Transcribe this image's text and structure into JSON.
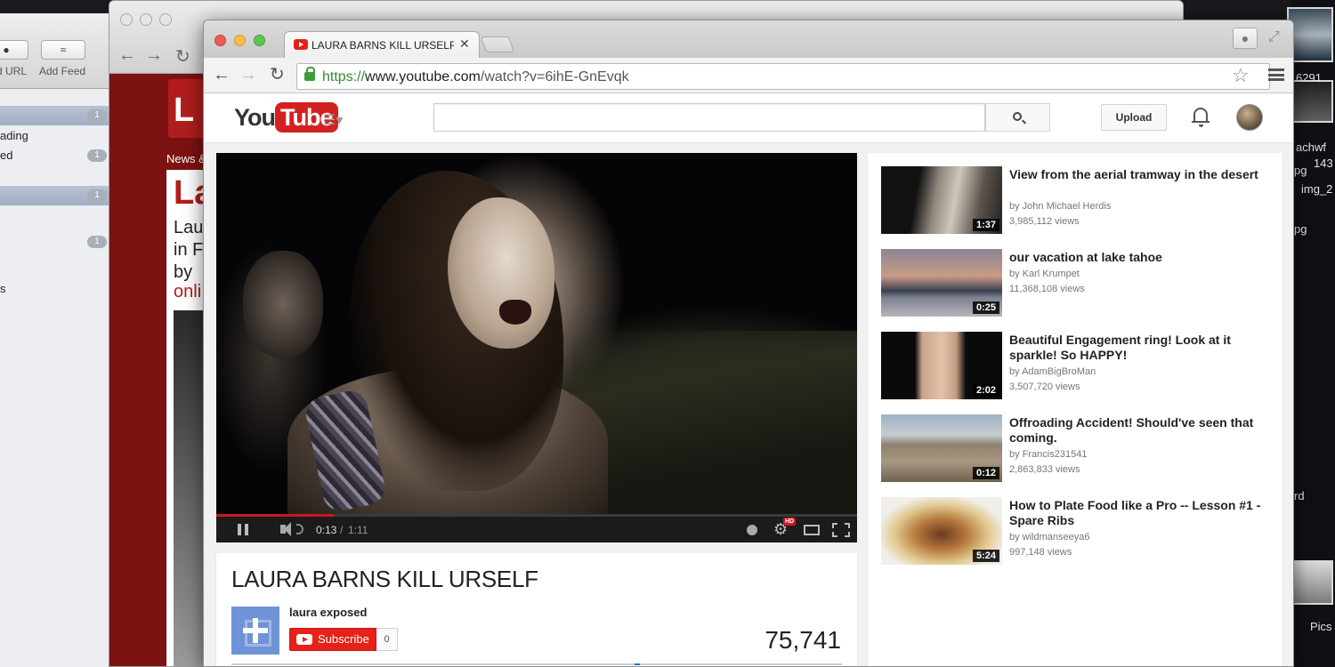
{
  "rss_window": {
    "toolbar": [
      {
        "label": "d URL"
      },
      {
        "label": "Add Feed"
      }
    ],
    "rows": [
      "ading",
      "ed",
      "s"
    ],
    "badges": [
      "1",
      "1",
      "1",
      "1"
    ]
  },
  "browser_back": {
    "section_label": "News &",
    "headline": "La",
    "lines": [
      "Lau",
      "in F",
      "by"
    ],
    "link_text": "onli"
  },
  "desktop": {
    "labels": [
      "6291",
      "achwf",
      "143",
      "img_2",
      "pg",
      "pg",
      "rd",
      "Pics"
    ]
  },
  "browser": {
    "tab_title": "LAURA BARNS KILL URSELF",
    "url_scheme": "https://",
    "url_host": "www.youtube.com",
    "url_path": "/watch?v=6ihE-GnEvqk"
  },
  "youtube": {
    "logo_you": "You",
    "logo_tube": "Tube",
    "search_placeholder": "",
    "upload_label": "Upload",
    "player": {
      "time_current": "0:13",
      "time_separator": "/",
      "time_duration": "1:11",
      "progress": 0.183,
      "hd_label": "HD"
    },
    "watch": {
      "title": "LAURA BARNS KILL URSELF",
      "channel": "laura exposed",
      "subscribe_label": "Subscribe",
      "subscriber_count": "0",
      "views": "75,741",
      "like_ratio": 0.66
    },
    "related": [
      {
        "title": "View from the aerial tramway in the desert",
        "by": "by John Michael Herdis",
        "views": "3,985,112 views",
        "duration": "1:37"
      },
      {
        "title": "our vacation at lake tahoe",
        "by": "by Karl Krumpet",
        "views": "11,368,108 views",
        "duration": "0:25"
      },
      {
        "title": "Beautiful Engagement ring! Look at it sparkle! So HAPPY!",
        "by": "by AdamBigBroMan",
        "views": "3,507,720 views",
        "duration": "2:02"
      },
      {
        "title": "Offroading Accident! Should've seen that coming.",
        "by": "by Francis231541",
        "views": "2,863,833 views",
        "duration": "0:12"
      },
      {
        "title": "How to Plate Food like a Pro -- Lesson #1 - Spare Ribs",
        "by": "by wildmanseeya6",
        "views": "997,148 views",
        "duration": "5:24"
      }
    ]
  },
  "colors": {
    "youtube_red": "#e62117",
    "url_green": "#2f8a2f",
    "progress_red": "#cc181e"
  }
}
